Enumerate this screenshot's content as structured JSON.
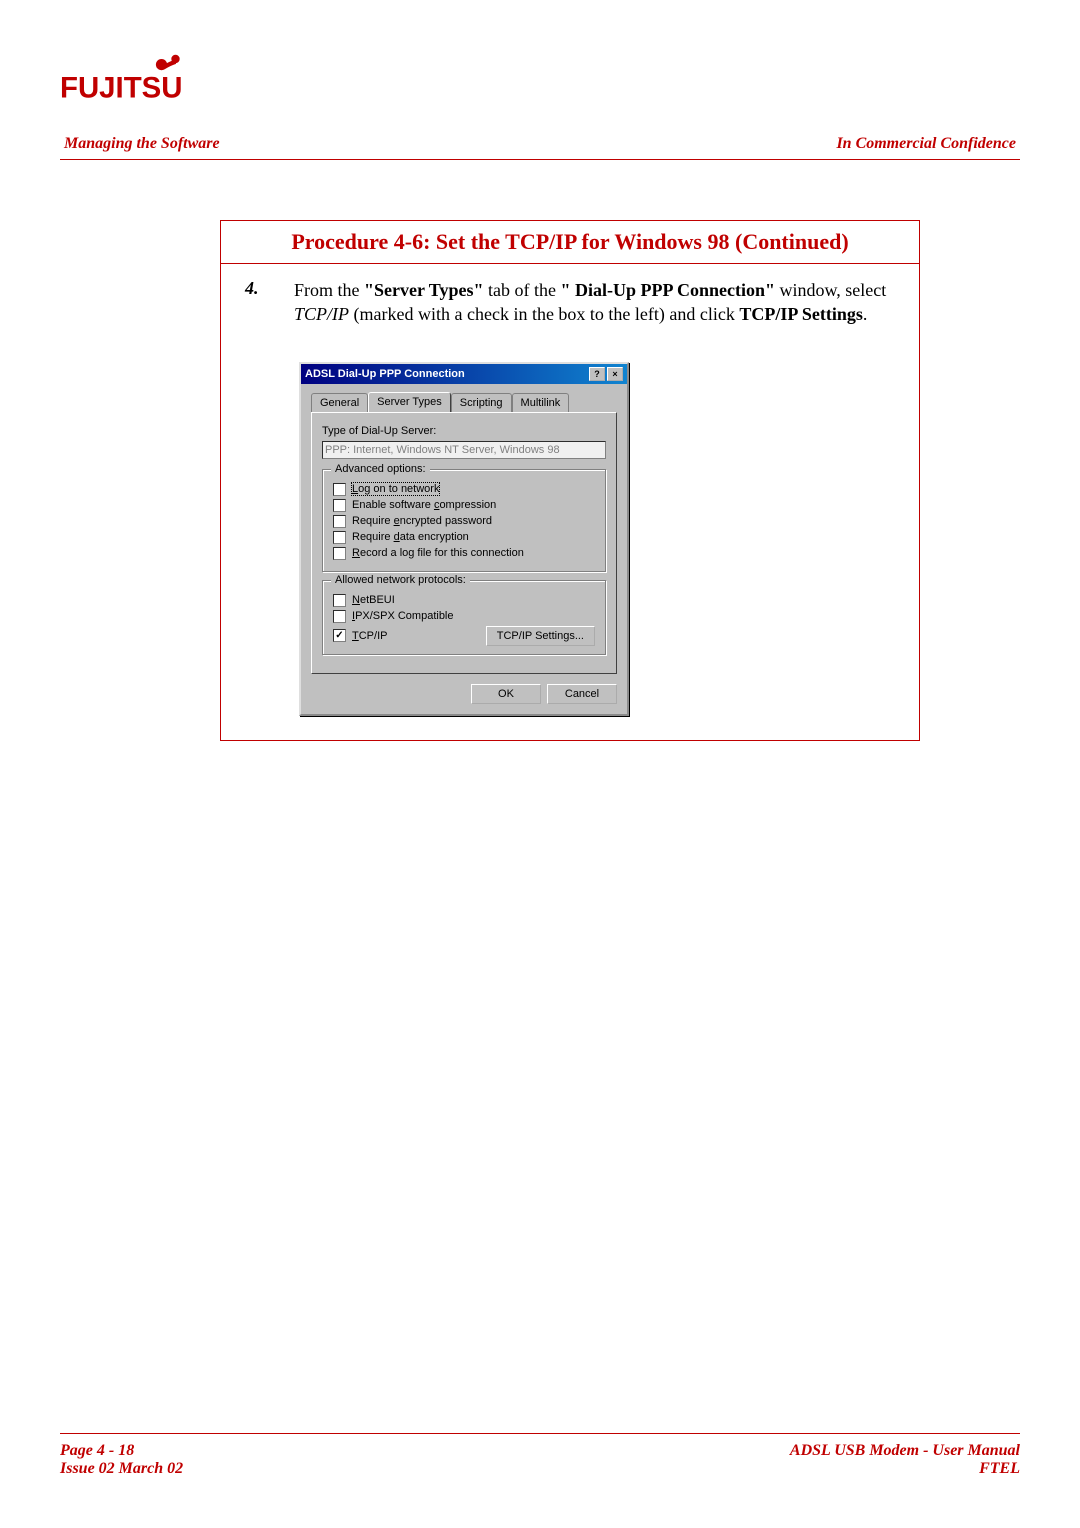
{
  "header": {
    "left": "Managing the Software",
    "right": "In Commercial Confidence"
  },
  "logo_text": "FUJITSU",
  "procedure": {
    "title": "Procedure 4-6: Set the TCP/IP for Windows 98 (Continued)",
    "step_number": "4.",
    "step_text_1": "From the ",
    "step_bold_1": "\"Server Types\"",
    "step_text_2": " tab of the ",
    "step_bold_2": "\" Dial-Up PPP Connection\"",
    "step_text_3": " window, select ",
    "step_ital_1": "TCP/IP",
    "step_text_4": " (marked with a check in the box to the left) and click ",
    "step_bold_3": "TCP/IP Settings",
    "step_text_5": "."
  },
  "dialog": {
    "title": "ADSL Dial-Up PPP Connection",
    "tabs": [
      "General",
      "Server Types",
      "Scripting",
      "Multilink"
    ],
    "active_tab": 1,
    "type_label": "Type of Dial-Up Server:",
    "type_value": "PPP: Internet, Windows NT Server, Windows 98",
    "group_advanced": "Advanced options:",
    "adv_options": [
      {
        "label": "Log on to network",
        "checked": false,
        "focus": true
      },
      {
        "label": "Enable software compression",
        "checked": false
      },
      {
        "label": "Require encrypted password",
        "checked": false
      },
      {
        "label": "Require data encryption",
        "checked": false
      },
      {
        "label": "Record a log file for this connection",
        "checked": false
      }
    ],
    "group_protocols": "Allowed network protocols:",
    "protocols": [
      {
        "label": "NetBEUI",
        "checked": false
      },
      {
        "label": "IPX/SPX Compatible",
        "checked": false
      },
      {
        "label": "TCP/IP",
        "checked": true
      }
    ],
    "tcpip_btn": "TCP/IP Settings...",
    "ok": "OK",
    "cancel": "Cancel",
    "help_icon": "?",
    "close_icon": "×"
  },
  "footer": {
    "page": "Page 4 - 18",
    "issue": "Issue 02 March 02",
    "manual": "ADSL USB Modem - User Manual",
    "org": "FTEL"
  }
}
